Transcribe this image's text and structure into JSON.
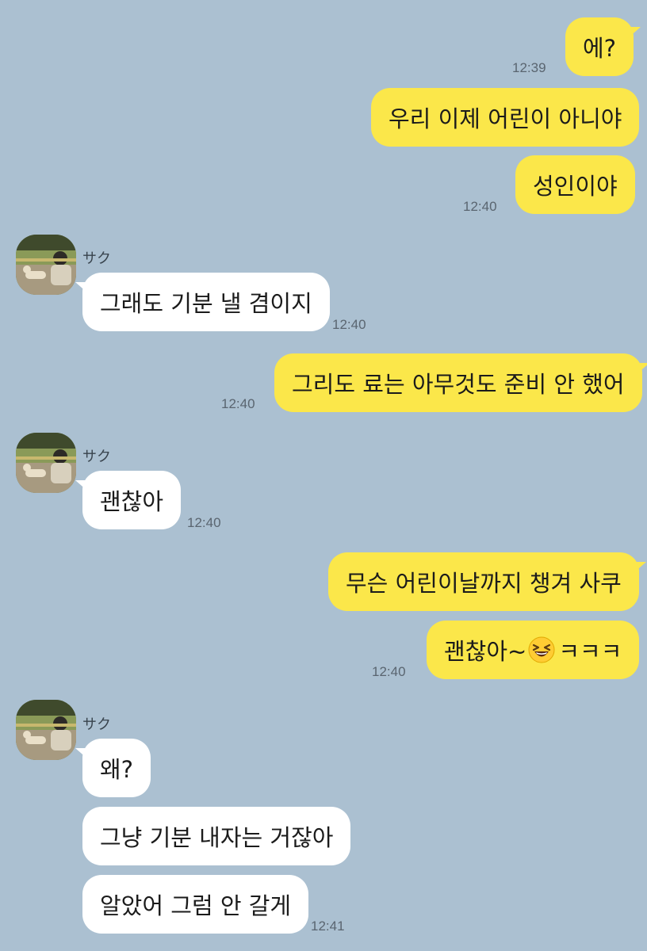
{
  "chat": {
    "contact": {
      "name": "サク",
      "avatar": "avatar-photo-icon"
    },
    "messages": [
      {
        "id": "m1",
        "direction": "out",
        "text": "에?",
        "time": "12:39"
      },
      {
        "id": "m2",
        "direction": "out",
        "text": "우리 이제 어린이 아니야",
        "time": ""
      },
      {
        "id": "m3",
        "direction": "out",
        "text": "성인이야",
        "time": "12:40"
      },
      {
        "id": "m4",
        "direction": "in",
        "sender": "サク",
        "text": "그래도 기분 낼 겸이지",
        "time": "12:40"
      },
      {
        "id": "m5",
        "direction": "out",
        "text": "그리도 료는 아무것도 준비 안 했어",
        "time": "12:40"
      },
      {
        "id": "m6",
        "direction": "in",
        "sender": "サク",
        "text": "괜찮아",
        "time": "12:40"
      },
      {
        "id": "m7",
        "direction": "out",
        "text": "무슨 어린이날까지 챙겨 사쿠",
        "time": ""
      },
      {
        "id": "m8",
        "direction": "out",
        "text_before": "괜찮아~",
        "emoji": "grinning-squinting-face-icon",
        "text_after": "ㅋㅋㅋ",
        "time": "12:40"
      },
      {
        "id": "m9",
        "direction": "in",
        "sender": "サク",
        "text": "왜?",
        "time": ""
      },
      {
        "id": "m10",
        "direction": "in",
        "text": "그냥 기분 내자는 거잖아",
        "time": ""
      },
      {
        "id": "m11",
        "direction": "in",
        "text": "알았어 그럼 안 갈게",
        "time": "12:41"
      }
    ]
  },
  "colors": {
    "background": "#abc0d1",
    "outgoing_bubble": "#fbe74a",
    "incoming_bubble": "#ffffff",
    "timestamp": "#5a6570"
  }
}
